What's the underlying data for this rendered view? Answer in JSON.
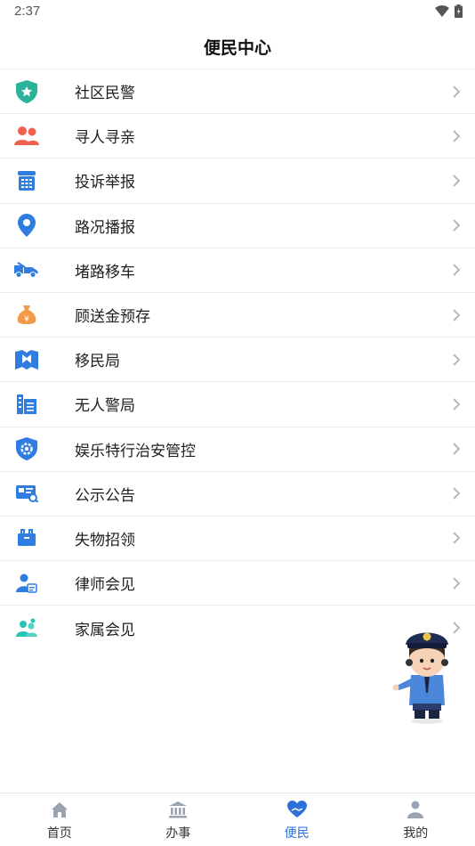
{
  "status_bar": {
    "time": "2:37"
  },
  "header": {
    "title": "便民中心"
  },
  "menu": [
    {
      "label": "社区民警",
      "icon": "shield-star-icon",
      "color": "#2bb39a"
    },
    {
      "label": "寻人寻亲",
      "icon": "people-icon",
      "color": "#f0624f"
    },
    {
      "label": "投诉举报",
      "icon": "telephone-icon",
      "color": "#2f7de1"
    },
    {
      "label": "路况播报",
      "icon": "location-pin-icon",
      "color": "#2f7de1"
    },
    {
      "label": "堵路移车",
      "icon": "tow-truck-icon",
      "color": "#2f7de1"
    },
    {
      "label": "顾送金预存",
      "icon": "money-bag-icon",
      "color": "#f39a4a"
    },
    {
      "label": "移民局",
      "icon": "map-book-icon",
      "color": "#2f7de1"
    },
    {
      "label": "无人警局",
      "icon": "building-icon",
      "color": "#2f7de1"
    },
    {
      "label": "娱乐特行治安管控",
      "icon": "shield-gear-icon",
      "color": "#2f7de1"
    },
    {
      "label": "公示公告",
      "icon": "notice-board-icon",
      "color": "#2f7de1"
    },
    {
      "label": "失物招领",
      "icon": "lost-box-icon",
      "color": "#2f7de1"
    },
    {
      "label": "律师会见",
      "icon": "lawyer-icon",
      "color": "#2f7de1"
    },
    {
      "label": "家属会见",
      "icon": "family-visit-icon",
      "color": "#2bc4b4"
    }
  ],
  "tabs": [
    {
      "label": "首页",
      "icon": "home-icon",
      "active": false
    },
    {
      "label": "办事",
      "icon": "government-building-icon",
      "active": false
    },
    {
      "label": "便民",
      "icon": "heart-hand-icon",
      "active": true
    },
    {
      "label": "我的",
      "icon": "person-icon",
      "active": false
    }
  ],
  "colors": {
    "accent": "#2f6fd8",
    "chevron": "#b8b8b8",
    "divider": "#ececec"
  }
}
